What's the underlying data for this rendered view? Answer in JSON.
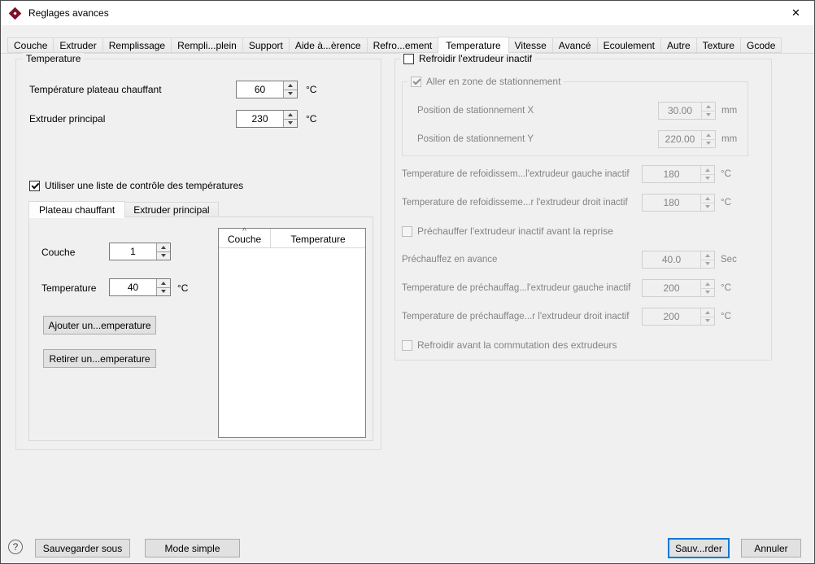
{
  "colors": {
    "accent": "#0078d7",
    "disabled_text": "#838383",
    "window_bg": "#f0f0f0"
  },
  "window": {
    "title": "Reglages avances",
    "close_glyph": "✕"
  },
  "tabs": {
    "items": [
      {
        "label": "Couche",
        "selected": false
      },
      {
        "label": "Extruder",
        "selected": false
      },
      {
        "label": "Remplissage",
        "selected": false
      },
      {
        "label": "Rempli...plein",
        "selected": false
      },
      {
        "label": "Support",
        "selected": false
      },
      {
        "label": "Aide à...èrence",
        "selected": false
      },
      {
        "label": "Refro...ement",
        "selected": false
      },
      {
        "label": "Temperature",
        "selected": true
      },
      {
        "label": "Vitesse",
        "selected": false
      },
      {
        "label": "Avancé",
        "selected": false
      },
      {
        "label": "Ecoulement",
        "selected": false
      },
      {
        "label": "Autre",
        "selected": false
      },
      {
        "label": "Texture",
        "selected": false
      },
      {
        "label": "Gcode",
        "selected": false
      }
    ]
  },
  "temperature_group": {
    "title": "Temperature",
    "bed": {
      "label": "Température plateau chauffant",
      "value": "60",
      "unit": "°C"
    },
    "extruder": {
      "label": "Extruder principal",
      "value": "230",
      "unit": "°C"
    },
    "use_temp_list": {
      "label": "Utiliser une liste de contrôle des températures",
      "checked": true
    },
    "inner_tabs": [
      {
        "label": "Plateau chauffant",
        "selected": true
      },
      {
        "label": "Extruder principal",
        "selected": false
      }
    ],
    "layer": {
      "label": "Couche",
      "value": "1"
    },
    "temperature": {
      "label": "Temperature",
      "value": "40",
      "unit": "°C"
    },
    "add_button": "Ajouter un...emperature",
    "remove_button": "Retirer un...emperature",
    "table": {
      "columns": [
        "Couche",
        "Temperature"
      ],
      "rows": []
    }
  },
  "cooling_group": {
    "title_checkbox": {
      "label": "Refroidir l'extrudeur inactif",
      "checked": false
    },
    "park_group": {
      "title_checkbox": {
        "label": "Aller en zone de stationnement",
        "checked": true
      },
      "x": {
        "label": "Position de stationnement X",
        "value": "30.00",
        "unit": "mm"
      },
      "y": {
        "label": "Position de stationnement Y",
        "value": "220.00",
        "unit": "mm"
      }
    },
    "cool_left": {
      "label": "Temperature de refoidissem...l'extrudeur gauche inactif",
      "value": "180",
      "unit": "°C"
    },
    "cool_right": {
      "label": "Temperature de refoidisseme...r l'extrudeur droit inactif",
      "value": "180",
      "unit": "°C"
    },
    "preheat_checkbox": {
      "label": "Préchauffer l'extrudeur inactif avant la reprise",
      "checked": false
    },
    "preheat_advance": {
      "label": "Préchauffez en avance",
      "value": "40.0",
      "unit": "Sec"
    },
    "preheat_left": {
      "label": "Temperature de préchauffag...l'extrudeur gauche inactif",
      "value": "200",
      "unit": "°C"
    },
    "preheat_right": {
      "label": "Temperature de préchauffage...r l'extrudeur droit inactif",
      "value": "200",
      "unit": "°C"
    },
    "cool_before_switch": {
      "label": "Refroidir avant la commutation des extrudeurs",
      "checked": false
    }
  },
  "footer": {
    "help": "?",
    "save_as": "Sauvegarder sous",
    "simple_mode": "Mode simple",
    "save": "Sauv...rder",
    "cancel": "Annuler"
  }
}
